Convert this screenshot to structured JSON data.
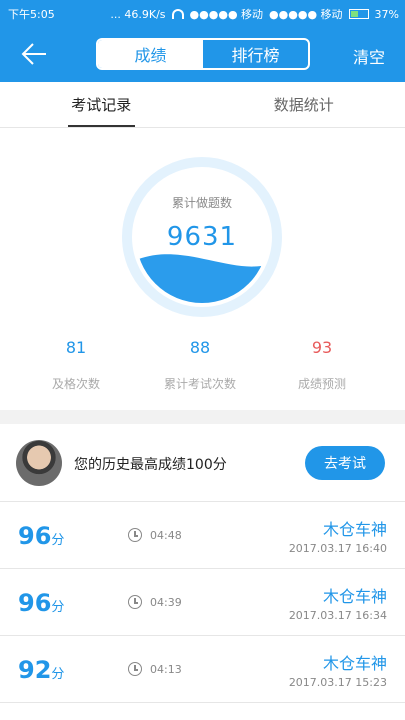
{
  "status_bar": {
    "time": "下午5:05",
    "network": "... 46.9K/s",
    "carrier1": "●●●●● 移动",
    "carrier2": "●●●●● 移动",
    "battery": "37%"
  },
  "header": {
    "back_icon": "arrow-left-icon",
    "segments": [
      {
        "label": "成绩",
        "active": true
      },
      {
        "label": "排行榜",
        "active": false
      }
    ],
    "clear_label": "清空"
  },
  "tabs": [
    {
      "label": "考试记录",
      "active": true
    },
    {
      "label": "数据统计",
      "active": false
    }
  ],
  "gauge": {
    "label": "累计做题数",
    "value": "9631",
    "fill_color": "#2b9cec",
    "ring_color": "#e3f2fd"
  },
  "stats": [
    {
      "value": "81",
      "label": "及格次数",
      "color": "#2196e8"
    },
    {
      "value": "88",
      "label": "累计考试次数",
      "color": "#2196e8"
    },
    {
      "value": "93",
      "label": "成绩预测",
      "color": "#e85b5b"
    }
  ],
  "best": {
    "text": "您的历史最高成绩100分",
    "button_label": "去考试"
  },
  "records": [
    {
      "score": "96",
      "unit": "分",
      "duration": "04:48",
      "name": "木仓车神",
      "time": "2017.03.17  16:40"
    },
    {
      "score": "96",
      "unit": "分",
      "duration": "04:39",
      "name": "木仓车神",
      "time": "2017.03.17  16:34"
    },
    {
      "score": "92",
      "unit": "分",
      "duration": "04:13",
      "name": "木仓车神",
      "time": "2017.03.17  15:23"
    }
  ],
  "colors": {
    "primary": "#2196e8",
    "accent_red": "#e85b5b"
  }
}
